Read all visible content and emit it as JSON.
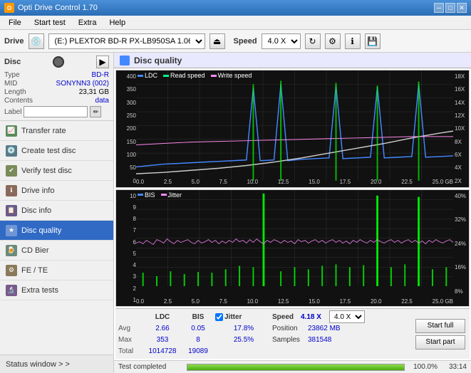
{
  "app": {
    "title": "Opti Drive Control 1.70",
    "icon": "ODC"
  },
  "titlebar": {
    "title": "Opti Drive Control 1.70",
    "minimize": "─",
    "maximize": "□",
    "close": "✕"
  },
  "menubar": {
    "items": [
      "File",
      "Start test",
      "Extra",
      "Help"
    ]
  },
  "toolbar": {
    "drive_label": "Drive",
    "drive_value": "(E:)  PLEXTOR BD-R  PX-LB950SA 1.06",
    "speed_label": "Speed",
    "speed_value": "4.0 X"
  },
  "disc": {
    "section_title": "Disc",
    "type_label": "Type",
    "type_value": "BD-R",
    "mid_label": "MID",
    "mid_value": "SONYNN3 (002)",
    "length_label": "Length",
    "length_value": "23,31 GB",
    "contents_label": "Contents",
    "contents_value": "data",
    "label_label": "Label",
    "label_placeholder": ""
  },
  "nav": {
    "items": [
      {
        "id": "transfer-rate",
        "label": "Transfer rate",
        "icon": "📈"
      },
      {
        "id": "create-test",
        "label": "Create test disc",
        "icon": "💿"
      },
      {
        "id": "verify-test",
        "label": "Verify test disc",
        "icon": "✔"
      },
      {
        "id": "drive-info",
        "label": "Drive info",
        "icon": "ℹ"
      },
      {
        "id": "disc-info",
        "label": "Disc info",
        "icon": "📋"
      },
      {
        "id": "disc-quality",
        "label": "Disc quality",
        "icon": "★",
        "active": true
      },
      {
        "id": "cd-bier",
        "label": "CD Bier",
        "icon": "🍺"
      },
      {
        "id": "fe-te",
        "label": "FE / TE",
        "icon": "⚙"
      },
      {
        "id": "extra-tests",
        "label": "Extra tests",
        "icon": "🔬"
      }
    ],
    "status_window": "Status window > >"
  },
  "disc_quality": {
    "title": "Disc quality",
    "legend": {
      "ldc": "LDC",
      "read_speed": "Read speed",
      "write_speed": "Write speed"
    },
    "chart1": {
      "y_labels_left": [
        "400",
        "350",
        "300",
        "250",
        "200",
        "150",
        "100",
        "50",
        "0"
      ],
      "y_labels_right": [
        "18X",
        "16X",
        "14X",
        "12X",
        "10X",
        "8X",
        "6X",
        "4X",
        "2X"
      ],
      "x_labels": [
        "0.0",
        "2.5",
        "5.0",
        "7.5",
        "10.0",
        "12.5",
        "15.0",
        "17.5",
        "20.0",
        "22.5",
        "25.0 GB"
      ]
    },
    "chart2": {
      "legend": {
        "bis": "BIS",
        "jitter": "Jitter"
      },
      "y_labels_left": [
        "10",
        "9",
        "8",
        "7",
        "6",
        "5",
        "4",
        "3",
        "2",
        "1"
      ],
      "y_labels_right": [
        "40%",
        "32%",
        "24%",
        "16%",
        "8%"
      ],
      "x_labels": [
        "0.0",
        "2.5",
        "5.0",
        "7.5",
        "10.0",
        "12.5",
        "15.0",
        "17.5",
        "20.0",
        "22.5",
        "25.0 GB"
      ]
    }
  },
  "stats": {
    "headers": [
      "",
      "LDC",
      "BIS",
      "",
      "Jitter",
      "Speed",
      ""
    ],
    "avg_label": "Avg",
    "avg_ldc": "2.66",
    "avg_bis": "0.05",
    "avg_jitter": "17.8%",
    "max_label": "Max",
    "max_ldc": "353",
    "max_bis": "8",
    "max_jitter": "25.5%",
    "total_label": "Total",
    "total_ldc": "1014728",
    "total_bis": "19089",
    "jitter_checked": true,
    "jitter_label": "Jitter",
    "speed_val": "4.18 X",
    "speed_select": "4.0 X",
    "position_label": "Position",
    "position_val": "23862 MB",
    "samples_label": "Samples",
    "samples_val": "381548",
    "start_full": "Start full",
    "start_part": "Start part"
  },
  "progress": {
    "status": "Test completed",
    "percent": "100.0%",
    "percent_num": 100,
    "time": "33:14"
  }
}
